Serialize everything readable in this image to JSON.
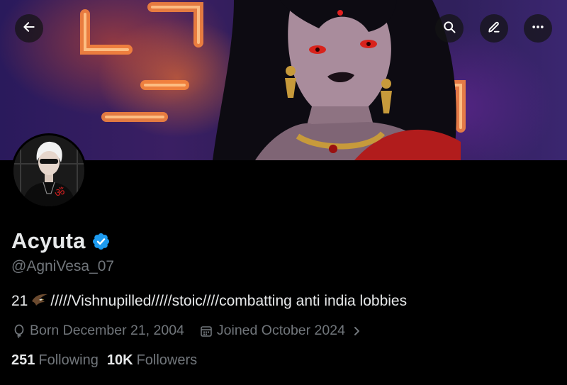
{
  "profile": {
    "display_name": "Acyuta",
    "verified": true,
    "handle": "@AgniVesa_07",
    "bio_prefix": "21",
    "bio_text": "/////Vishnupilled/////stoic////combatting anti india lobbies",
    "birth": "Born December 21, 2004",
    "joined": "Joined October 2024",
    "following_count": "251",
    "following_label": "Following",
    "followers_count": "10K",
    "followers_label": "Followers"
  },
  "icons": {
    "back": "arrow-left-icon",
    "search": "search-icon",
    "edit": "pencil-icon",
    "more": "more-horizontal-icon",
    "verified": "verified-badge-icon",
    "location": "balloon-icon",
    "calendar": "calendar-icon",
    "chevron": "chevron-right-icon"
  },
  "colors": {
    "background": "#000000",
    "primary_text": "#e7e9ea",
    "secondary_text": "#71767b",
    "verified_blue": "#1d9bf0"
  }
}
